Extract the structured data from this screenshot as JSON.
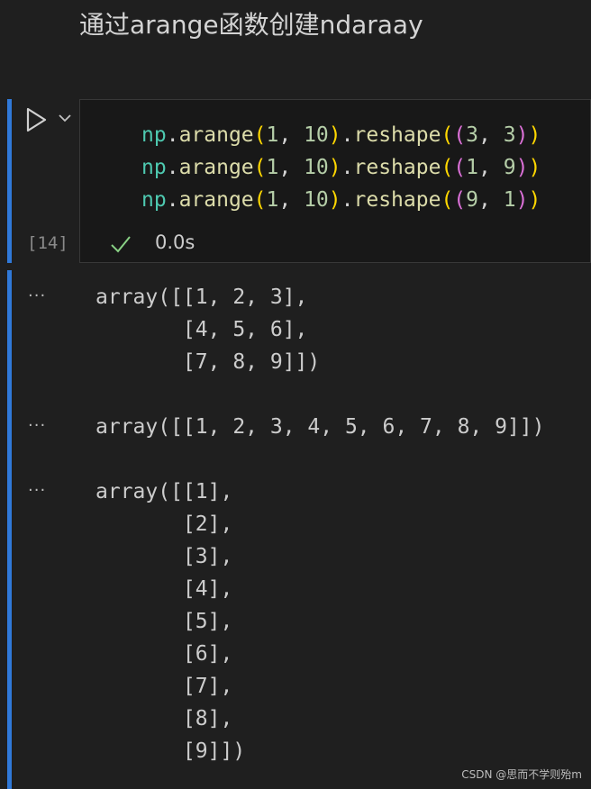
{
  "markdown": {
    "title": "通过arange函数创建ndaraay"
  },
  "cell": {
    "execution_count": "[14]",
    "status_time": "0.0s",
    "code_lines": [
      [
        {
          "t": "np",
          "c": "t-mod"
        },
        {
          "t": ".",
          "c": "t-pl"
        },
        {
          "t": "arange",
          "c": "t-fn"
        },
        {
          "t": "(",
          "c": "t-p1"
        },
        {
          "t": "1",
          "c": "t-num"
        },
        {
          "t": ", ",
          "c": "t-pl"
        },
        {
          "t": "10",
          "c": "t-num"
        },
        {
          "t": ")",
          "c": "t-p1"
        },
        {
          "t": ".",
          "c": "t-pl"
        },
        {
          "t": "reshape",
          "c": "t-fn"
        },
        {
          "t": "(",
          "c": "t-p1"
        },
        {
          "t": "(",
          "c": "t-p2"
        },
        {
          "t": "3",
          "c": "t-num"
        },
        {
          "t": ", ",
          "c": "t-pl"
        },
        {
          "t": "3",
          "c": "t-num"
        },
        {
          "t": ")",
          "c": "t-p2"
        },
        {
          "t": ")",
          "c": "t-p1"
        }
      ],
      [
        {
          "t": "np",
          "c": "t-mod"
        },
        {
          "t": ".",
          "c": "t-pl"
        },
        {
          "t": "arange",
          "c": "t-fn"
        },
        {
          "t": "(",
          "c": "t-p1"
        },
        {
          "t": "1",
          "c": "t-num"
        },
        {
          "t": ", ",
          "c": "t-pl"
        },
        {
          "t": "10",
          "c": "t-num"
        },
        {
          "t": ")",
          "c": "t-p1"
        },
        {
          "t": ".",
          "c": "t-pl"
        },
        {
          "t": "reshape",
          "c": "t-fn"
        },
        {
          "t": "(",
          "c": "t-p1"
        },
        {
          "t": "(",
          "c": "t-p2"
        },
        {
          "t": "1",
          "c": "t-num"
        },
        {
          "t": ", ",
          "c": "t-pl"
        },
        {
          "t": "9",
          "c": "t-num"
        },
        {
          "t": ")",
          "c": "t-p2"
        },
        {
          "t": ")",
          "c": "t-p1"
        }
      ],
      [
        {
          "t": "np",
          "c": "t-mod"
        },
        {
          "t": ".",
          "c": "t-pl"
        },
        {
          "t": "arange",
          "c": "t-fn"
        },
        {
          "t": "(",
          "c": "t-p1"
        },
        {
          "t": "1",
          "c": "t-num"
        },
        {
          "t": ", ",
          "c": "t-pl"
        },
        {
          "t": "10",
          "c": "t-num"
        },
        {
          "t": ")",
          "c": "t-p1"
        },
        {
          "t": ".",
          "c": "t-pl"
        },
        {
          "t": "reshape",
          "c": "t-fn"
        },
        {
          "t": "(",
          "c": "t-p1"
        },
        {
          "t": "(",
          "c": "t-p2"
        },
        {
          "t": "9",
          "c": "t-num"
        },
        {
          "t": ", ",
          "c": "t-pl"
        },
        {
          "t": "1",
          "c": "t-num"
        },
        {
          "t": ")",
          "c": "t-p2"
        },
        {
          "t": ")",
          "c": "t-p1"
        }
      ]
    ]
  },
  "outputs": [
    {
      "ellipsis": "···",
      "text": "array([[1, 2, 3],\n       [4, 5, 6],\n       [7, 8, 9]])"
    },
    {
      "ellipsis": "···",
      "text": "array([[1, 2, 3, 4, 5, 6, 7, 8, 9]])"
    },
    {
      "ellipsis": "···",
      "text": "array([[1],\n       [2],\n       [3],\n       [4],\n       [5],\n       [6],\n       [7],\n       [8],\n       [9]])"
    }
  ],
  "watermark": "CSDN @思而不学则殆m",
  "icons": {
    "run": "play-icon",
    "menu": "chevron-down-icon",
    "status": "check-icon"
  },
  "colors": {
    "accent_bar": "#3079d8",
    "background": "#1f1f1f",
    "check": "#89d185"
  }
}
